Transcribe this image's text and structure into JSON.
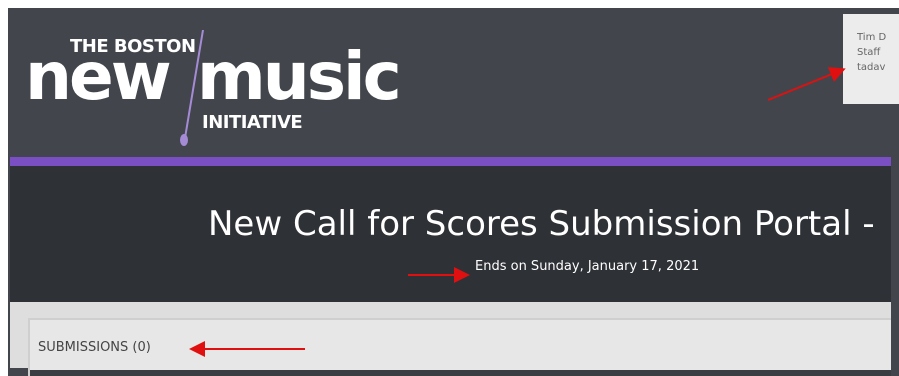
{
  "header": {
    "logo": {
      "line_small_top": "THE BOSTON",
      "word_new": "new",
      "word_music": "music",
      "line_small_bottom": "INITIATIVE"
    },
    "user_panel": {
      "line1": "Tim D",
      "line2": "Staff",
      "line3": "tadav"
    }
  },
  "portal": {
    "title": "New Call for Scores Submission Portal -",
    "deadline": "Ends on Sunday, January 17, 2021"
  },
  "submissions": {
    "label": "SUBMISSIONS (0)"
  },
  "colors": {
    "header_bg": "#42464c",
    "accent_bar": "#7b4fc4",
    "title_panel_bg": "#2e3136",
    "annotation_arrow": "#e01010"
  }
}
